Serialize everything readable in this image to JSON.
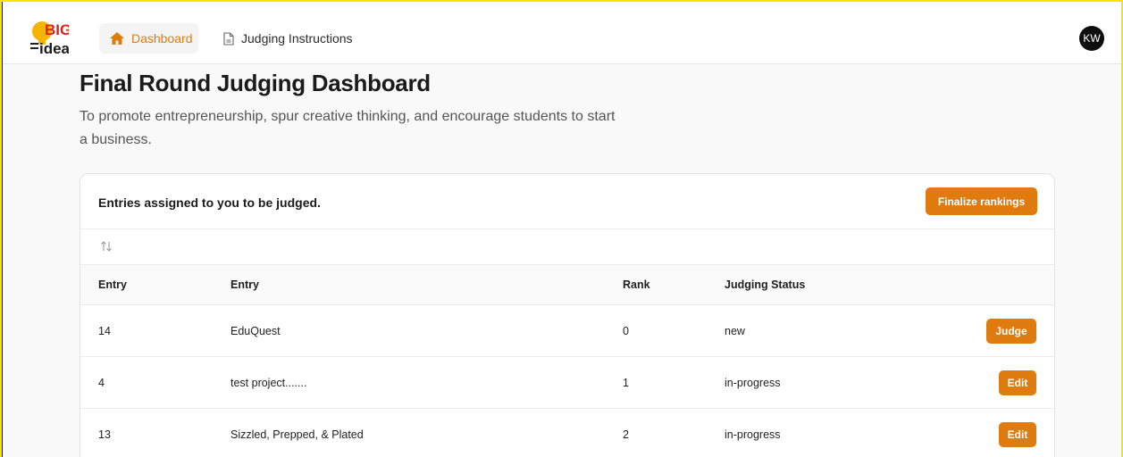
{
  "logo": {
    "line1": "BIG",
    "line2": "idea"
  },
  "nav": {
    "dashboard_label": "Dashboard",
    "judging_label": "Judging Instructions"
  },
  "user": {
    "initials": "KW"
  },
  "page": {
    "title": "Final Round Judging Dashboard",
    "subtitle": "To promote entrepreneurship, spur creative thinking, and encourage students to start a business."
  },
  "card": {
    "title": "Entries assigned to you to be judged.",
    "finalize_label": "Finalize rankings"
  },
  "table": {
    "headers": [
      "Entry",
      "Entry",
      "Rank",
      "Judging Status"
    ],
    "rows": [
      {
        "id": "14",
        "name": "EduQuest",
        "rank": "0",
        "status": "new",
        "action": "Judge"
      },
      {
        "id": "4",
        "name": "test project.......",
        "rank": "1",
        "status": "in-progress",
        "action": "Edit"
      },
      {
        "id": "13",
        "name": "Sizzled, Prepped, & Plated",
        "rank": "2",
        "status": "in-progress",
        "action": "Edit"
      }
    ]
  },
  "colors": {
    "accent": "#df7b0f",
    "frame": "#f5e600",
    "logo_red": "#d9231d",
    "logo_bulb": "#f5b400"
  }
}
